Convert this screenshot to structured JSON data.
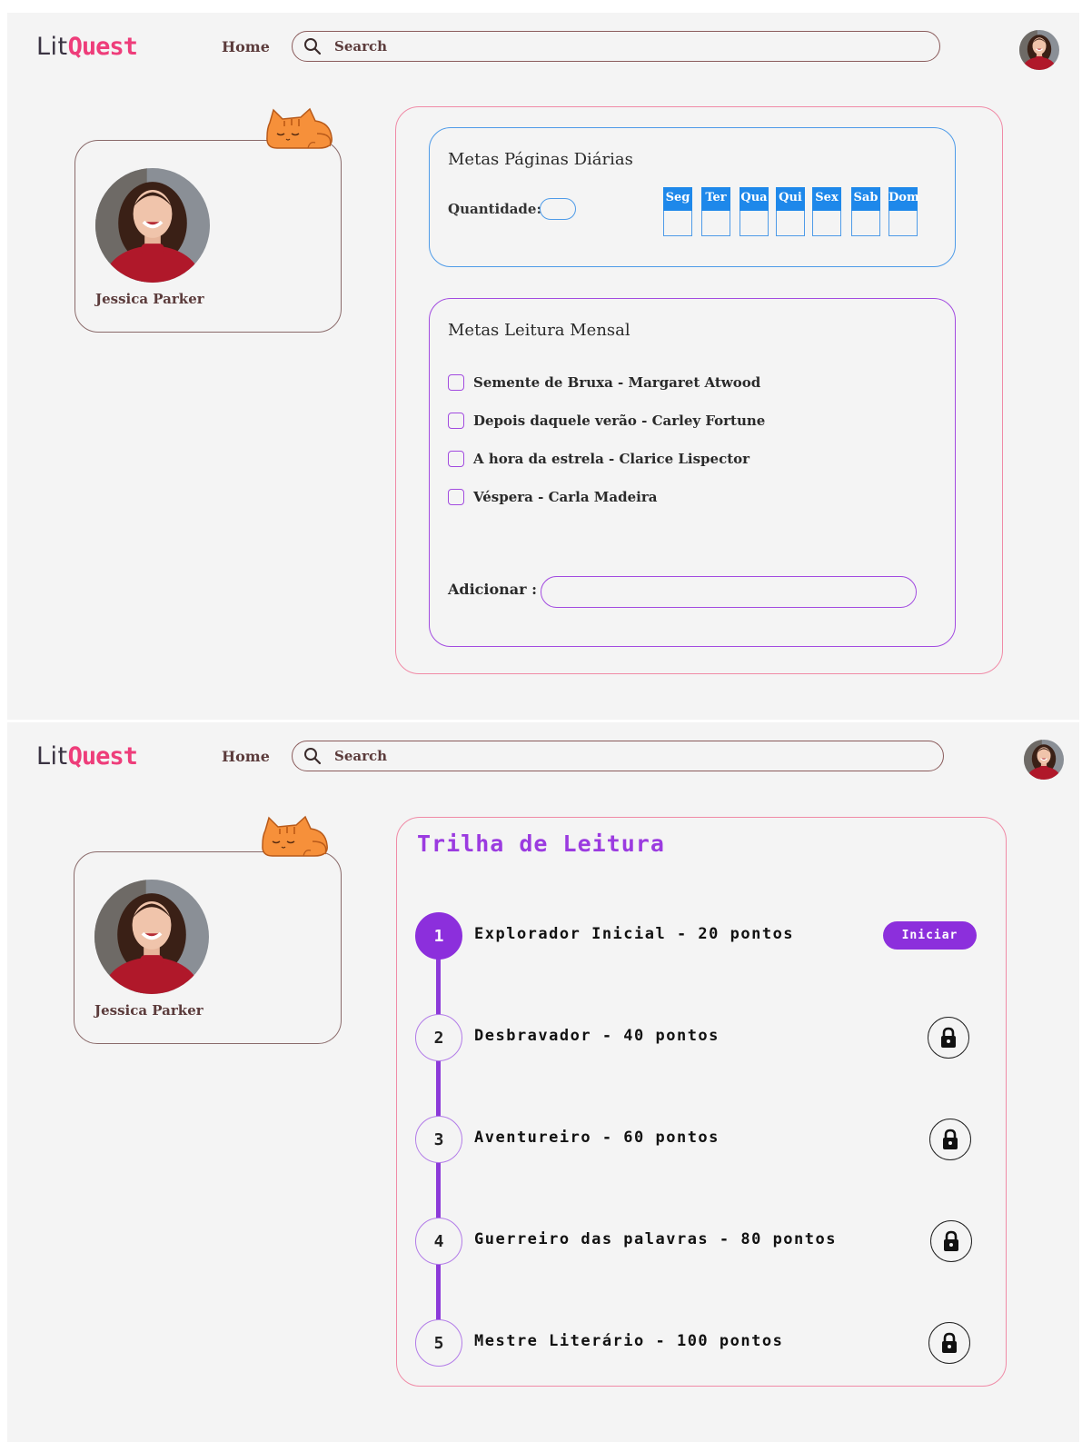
{
  "brand": {
    "lit": "Lit",
    "quest": "Quest"
  },
  "nav": {
    "home": "Home"
  },
  "search": {
    "placeholder": "Search"
  },
  "profile": {
    "name": "Jessica Parker"
  },
  "daily_goals": {
    "title": "Metas Páginas Diárias",
    "quantity_label": "Quantidade:",
    "days": [
      "Seg",
      "Ter",
      "Qua",
      "Qui",
      "Sex",
      "Sab",
      "Dom"
    ]
  },
  "monthly_goals": {
    "title": "Metas Leitura Mensal",
    "books": [
      "Semente de Bruxa - Margaret Atwood",
      "Depois daquele verão - Carley Fortune",
      "A hora da estrela - Clarice Lispector",
      "Véspera - Carla Madeira"
    ],
    "add_label": "Adicionar :"
  },
  "trail": {
    "title": "Trilha de Leitura",
    "steps": [
      {
        "num": "1",
        "label": "Explorador Inicial - 20 pontos"
      },
      {
        "num": "2",
        "label": "Desbravador - 40 pontos"
      },
      {
        "num": "3",
        "label": "Aventureiro - 60 pontos"
      },
      {
        "num": "4",
        "label": "Guerreiro das palavras - 80 pontos"
      },
      {
        "num": "5",
        "label": "Mestre Literário - 100 pontos"
      }
    ],
    "start_button": "Iniciar"
  },
  "colors": {
    "brand_pink": "#ee3d7a",
    "primary_blue": "#1e88ea",
    "accent_purple": "#8c2fdc",
    "panel_pink_border": "#f08aa6"
  }
}
